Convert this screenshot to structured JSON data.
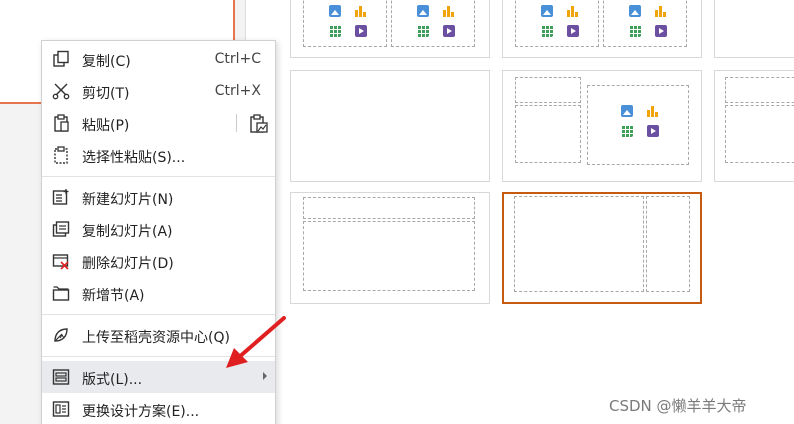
{
  "menu": {
    "copy": {
      "label": "复制(C)",
      "shortcut": "Ctrl+C",
      "icon": "copy-icon"
    },
    "cut": {
      "label": "剪切(T)",
      "shortcut": "Ctrl+X",
      "icon": "scissors-icon"
    },
    "paste": {
      "label": "粘贴(P)",
      "icon": "clipboard-icon",
      "paste_option_icon": "paste-picture-icon"
    },
    "paste_special": {
      "label": "选择性粘贴(S)...",
      "icon": "paste-special-icon"
    },
    "new_slide": {
      "label": "新建幻灯片(N)",
      "icon": "new-slide-icon"
    },
    "duplicate_slide": {
      "label": "复制幻灯片(A)",
      "icon": "duplicate-slide-icon"
    },
    "delete_slide": {
      "label": "删除幻灯片(D)",
      "icon": "delete-slide-icon"
    },
    "add_section": {
      "label": "新增节(A)",
      "icon": "section-icon"
    },
    "upload": {
      "label": "上传至稻壳资源中心(Q)",
      "icon": "upload-leaf-icon"
    },
    "layout": {
      "label": "版式(L)...",
      "icon": "layout-icon",
      "highlighted": true
    },
    "change_design": {
      "label": "更换设计方案(E)...",
      "icon": "design-icon"
    }
  },
  "colors": {
    "accent": "#c55a11",
    "slide_border": "#e8734f",
    "annotation_arrow": "#e02020",
    "menu_hover": "#e8eaed"
  },
  "watermark": "CSDN @懒羊羊大帝"
}
